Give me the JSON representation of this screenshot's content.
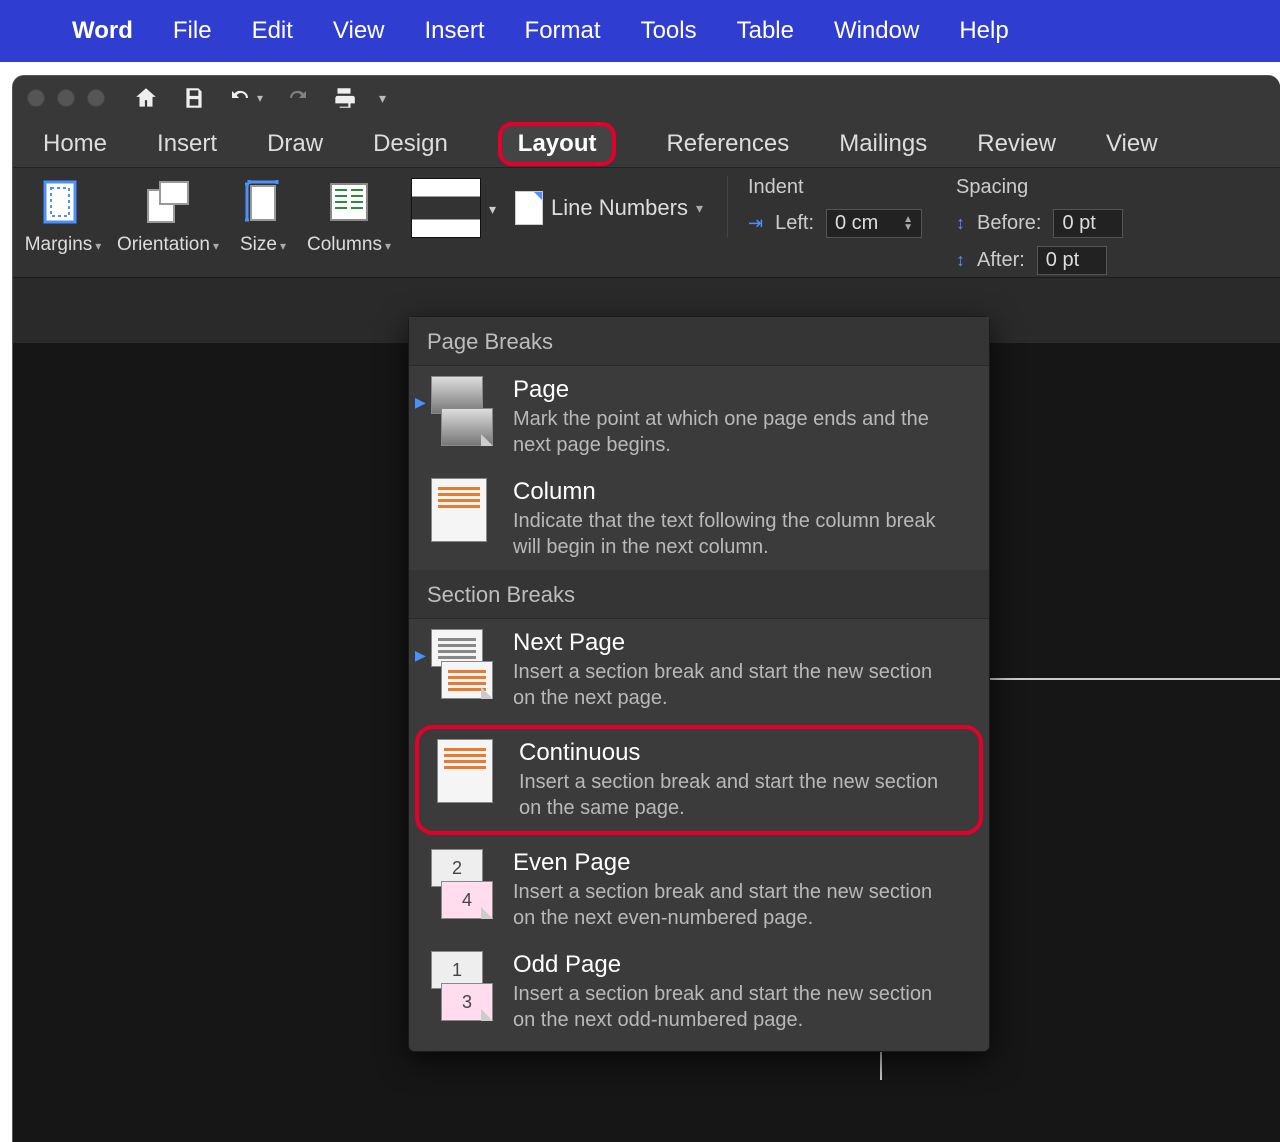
{
  "menubar": {
    "app": "Word",
    "items": [
      "File",
      "Edit",
      "View",
      "Insert",
      "Format",
      "Tools",
      "Table",
      "Window",
      "Help"
    ]
  },
  "ribbon_tabs": [
    "Home",
    "Insert",
    "Draw",
    "Design",
    "Layout",
    "References",
    "Mailings",
    "Review",
    "View"
  ],
  "active_tab": "Layout",
  "ribbon": {
    "margins": "Margins",
    "orientation": "Orientation",
    "size": "Size",
    "columns": "Columns",
    "line_numbers": "Line Numbers",
    "indent_label": "Indent",
    "left_label": "Left:",
    "left_value": "0 cm",
    "spacing_label": "Spacing",
    "before_label": "Before:",
    "before_value": "0 pt",
    "after_label": "After:",
    "after_value": "0 pt"
  },
  "dropdown": {
    "section1": "Page Breaks",
    "section2": "Section Breaks",
    "items": {
      "page": {
        "title": "Page",
        "desc": "Mark the point at which one page ends and the next page begins."
      },
      "column": {
        "title": "Column",
        "desc": "Indicate that the text following the column break will begin in the next column."
      },
      "next_page": {
        "title": "Next Page",
        "desc": "Insert a section break and start the new section on the next page."
      },
      "continuous": {
        "title": "Continuous",
        "desc": "Insert a section break and start the new section on the same page."
      },
      "even_page": {
        "title": "Even Page",
        "desc": "Insert a section break and start the new section on the next even-numbered page."
      },
      "odd_page": {
        "title": "Odd Page",
        "desc": "Insert a section break and start the new section on the next odd-numbered page."
      }
    }
  }
}
